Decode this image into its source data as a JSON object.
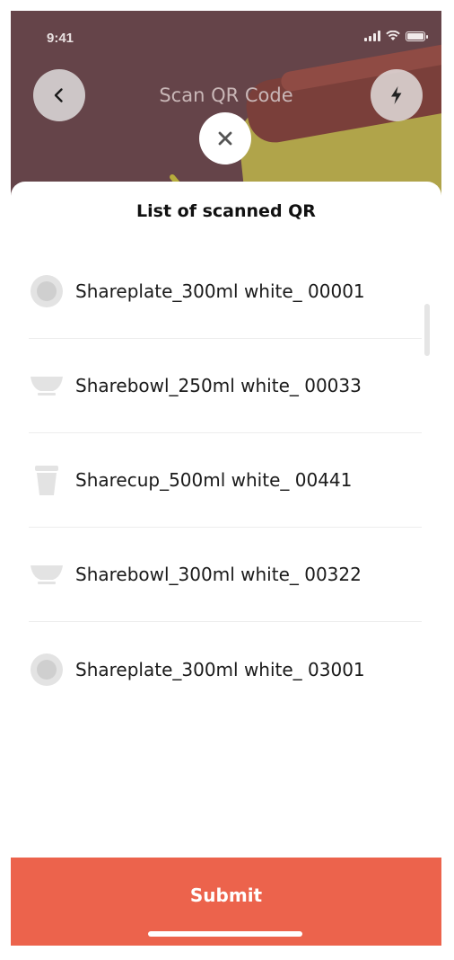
{
  "status_bar": {
    "time": "9:41"
  },
  "header": {
    "title": "Scan QR Code",
    "back_icon": "chevron-left-icon",
    "flash_icon": "lightning-icon",
    "close_icon": "close-icon"
  },
  "sheet": {
    "title": "List of scanned QR",
    "items": [
      {
        "label": "Shareplate_300ml white_ 00001",
        "icon": "plate-icon"
      },
      {
        "label": "Sharebowl_250ml white_ 00033",
        "icon": "bowl-icon"
      },
      {
        "label": "Sharecup_500ml white_ 00441",
        "icon": "cup-icon"
      },
      {
        "label": "Sharebowl_300ml white_ 00322",
        "icon": "bowl-icon"
      },
      {
        "label": "Shareplate_300ml white_ 03001",
        "icon": "plate-icon"
      }
    ]
  },
  "footer": {
    "submit_label": "Submit"
  },
  "colors": {
    "accent": "#EC634C",
    "camera_bg": "#654449"
  }
}
